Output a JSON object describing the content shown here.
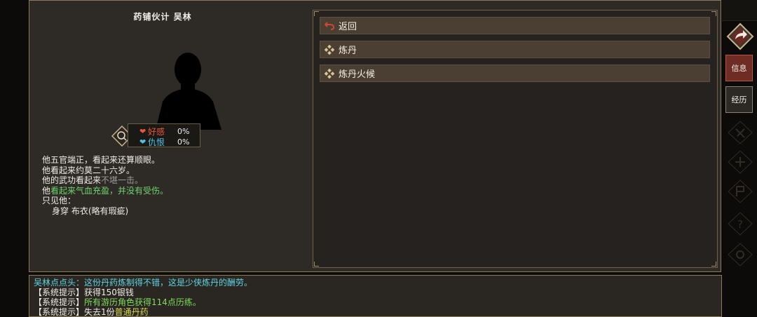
{
  "npc": {
    "title": "药铺伙计  吴林",
    "relations": [
      {
        "label": "好感",
        "value": "0%",
        "color": "#e8583c"
      },
      {
        "label": "仇恨",
        "value": "0%",
        "color": "#4cc4e8"
      }
    ],
    "description": [
      [
        {
          "text": "他五官端正，看起来还算顺眼。",
          "style": ""
        }
      ],
      [
        {
          "text": "他看起来约莫二十六岁。",
          "style": ""
        }
      ],
      [
        {
          "text": "他的武功看起来",
          "style": ""
        },
        {
          "text": "不堪一击。",
          "style": "grey"
        }
      ],
      [
        {
          "text": "他",
          "style": ""
        },
        {
          "text": "看起来气血充盈，并没有受伤。",
          "style": "green"
        }
      ],
      [
        {
          "text": "只见他：",
          "style": ""
        }
      ],
      [
        {
          "text": "身穿 布衣(略有瑕疵)",
          "style": "indent"
        }
      ]
    ]
  },
  "menu": {
    "items": [
      {
        "label": "返回",
        "icon": "return-arrow-icon"
      },
      {
        "label": "炼丹",
        "icon": "diamond-bullet-icon"
      },
      {
        "label": "炼丹火候",
        "icon": "diamond-bullet-icon"
      }
    ]
  },
  "log": {
    "lines": [
      [
        {
          "text": "吴林点点头：这份丹药炼制得不错，这是少侠炼丹的酬劳。",
          "style": "cyan"
        }
      ],
      [
        {
          "text": "【系统提示】",
          "style": ""
        },
        {
          "text": "获得150银钱",
          "style": ""
        }
      ],
      [
        {
          "text": "【系统提示】",
          "style": ""
        },
        {
          "text": "所有游历角色获得114点历练。",
          "style": "lg"
        }
      ],
      [
        {
          "text": "【系统提示】",
          "style": ""
        },
        {
          "text": "失去1份",
          "style": ""
        },
        {
          "text": "普通丹药",
          "style": "yel"
        }
      ]
    ]
  },
  "sidebar": {
    "tabs": [
      {
        "label": "信息",
        "active": true
      },
      {
        "label": "经历",
        "active": false
      }
    ],
    "ghost_icons": [
      "work-icon",
      "study-icon",
      "faction-icon",
      "help-icon",
      "settings-icon"
    ]
  },
  "colors": {
    "panel": "#2e2a25",
    "border": "#8c7a5b",
    "menu_item": "#4a3f32",
    "active_tab": "#6e2c24"
  }
}
